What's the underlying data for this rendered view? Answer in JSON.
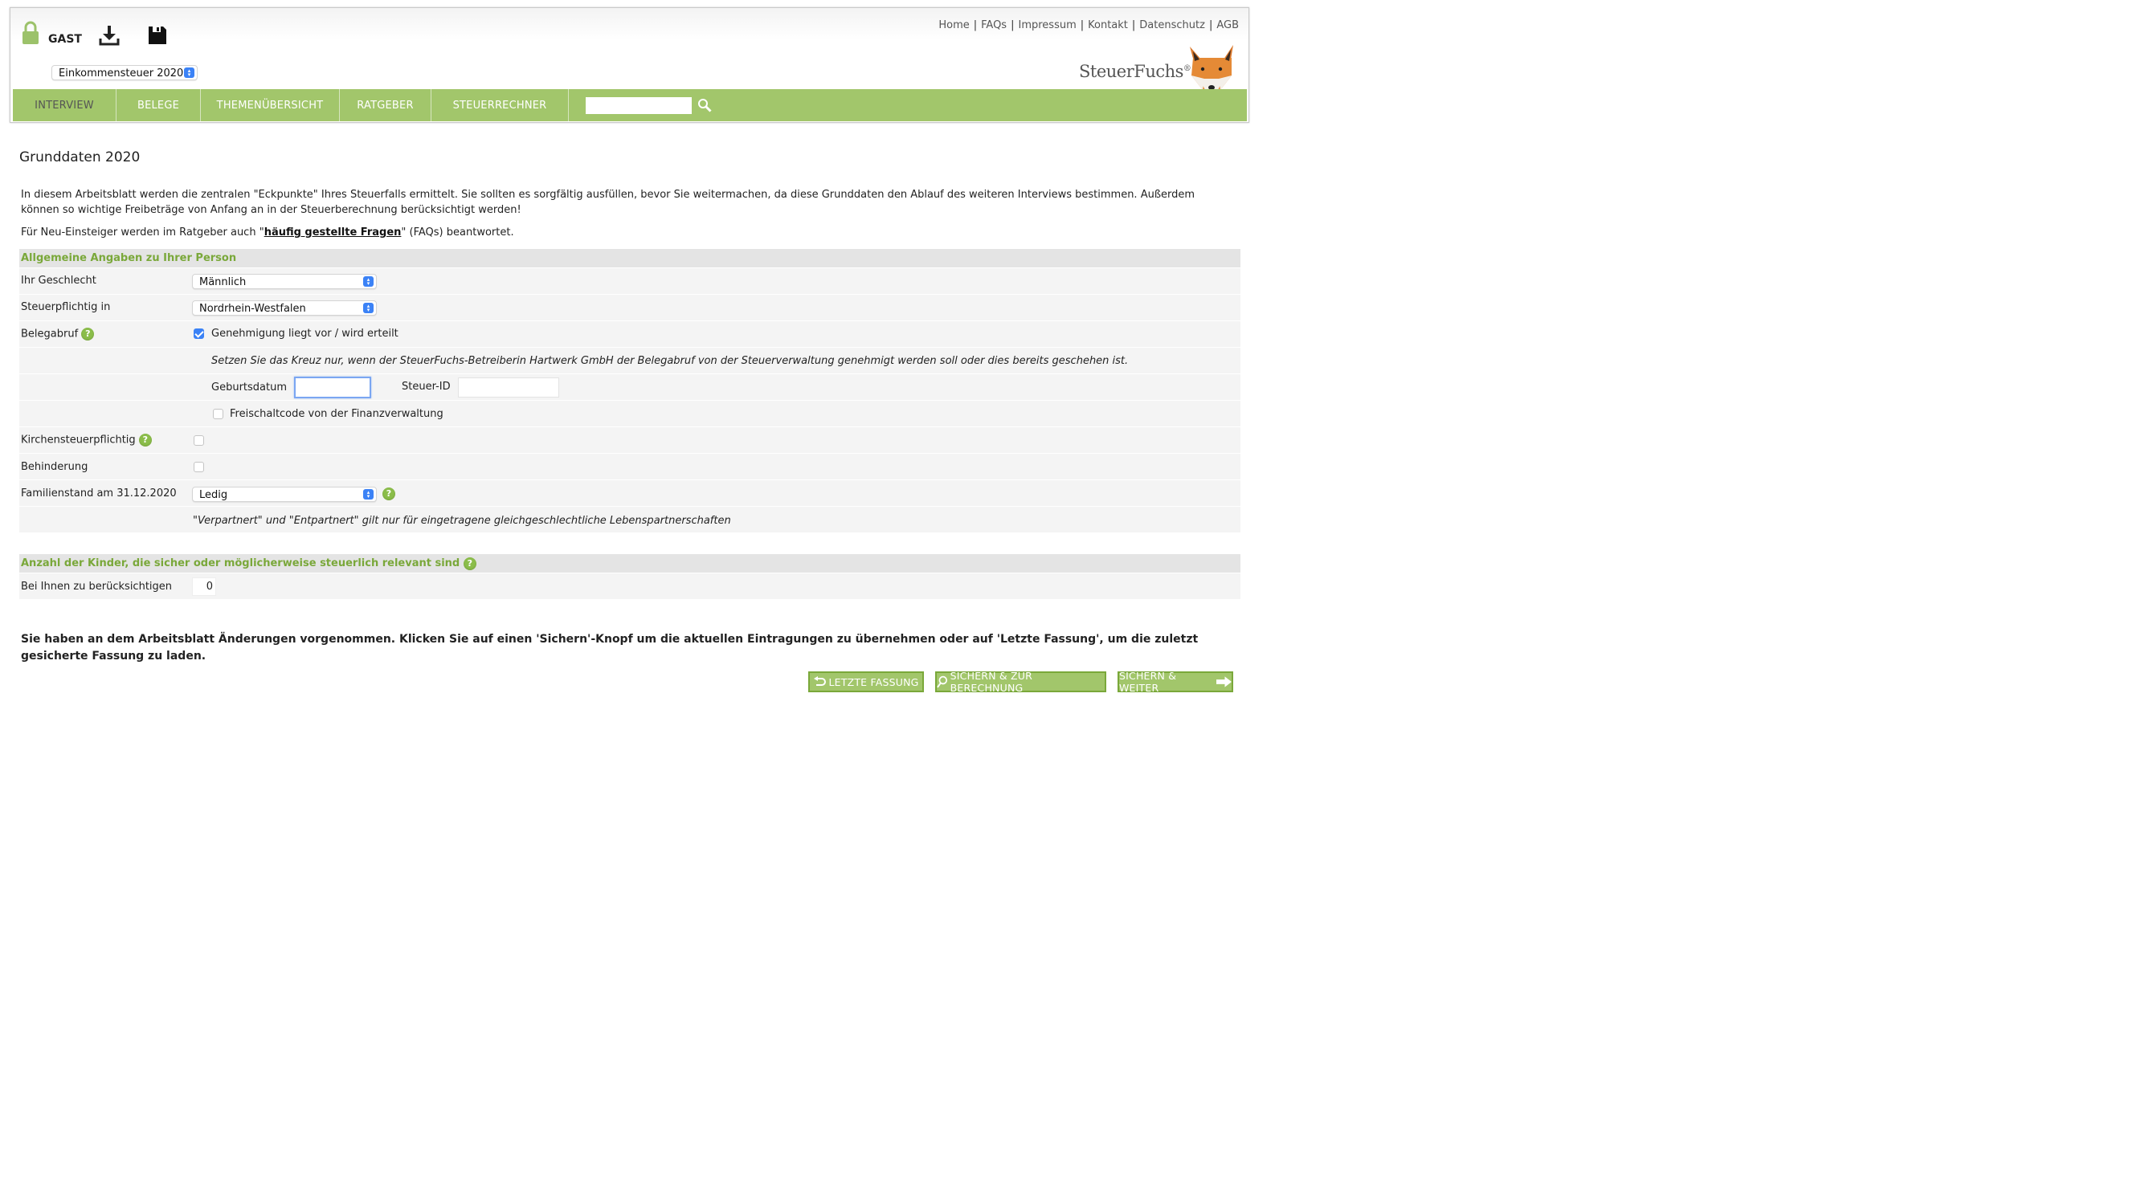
{
  "header": {
    "user_label": "GAST",
    "tax_year_select": "Einkommensteuer 2020",
    "top_links": [
      "Home",
      "FAQs",
      "Impressum",
      "Kontakt",
      "Datenschutz",
      "AGB"
    ],
    "logo_text": "SteuerFuchs",
    "logo_mark": "®"
  },
  "nav": {
    "items": [
      "INTERVIEW",
      "BELEGE",
      "THEMENÜBERSICHT",
      "RATGEBER",
      "STEUERRECHNER"
    ],
    "search_value": ""
  },
  "page": {
    "title": "Grunddaten 2020",
    "intro": "In diesem Arbeitsblatt werden die zentralen \"Eckpunkte\" Ihres Steuerfalls ermittelt. Sie sollten es sorgfältig ausfüllen, bevor Sie weitermachen, da diese Grunddaten den Ablauf des weiteren Interviews bestimmen. Außerdem können so wichtige Freibeträge von Anfang an in der Steuerberechnung berücksichtigt werden!",
    "faq_prefix": "Für Neu-Einsteiger werden im Ratgeber auch \"",
    "faq_link": "häufig gestellte Fragen",
    "faq_suffix": "\" (FAQs) beantwortet."
  },
  "section1": {
    "title": "Allgemeine Angaben zu Ihrer Person",
    "gender_label": "Ihr Geschlecht",
    "gender_value": "Männlich",
    "state_label": "Steuerpflichtig in",
    "state_value": "Nordrhein-Westfalen",
    "belegabruf_label": "Belegabruf",
    "belegabruf_checkbox_label": "Genehmigung liegt vor / wird erteilt",
    "belegabruf_checked": true,
    "belegabruf_note": "Setzen Sie das Kreuz nur, wenn der SteuerFuchs-Betreiberin Hartwerk GmbH der Belegabruf von der Steuerverwaltung genehmigt werden soll oder dies bereits geschehen ist.",
    "birthdate_label": "Geburtsdatum",
    "birthdate_value": "",
    "taxid_label": "Steuer-ID",
    "taxid_value": "",
    "activation_label": "Freischaltcode von der Finanzverwaltung",
    "activation_checked": false,
    "church_label": "Kirchensteuerpflichtig",
    "church_checked": false,
    "disability_label": "Behinderung",
    "disability_checked": false,
    "marital_label": "Familienstand am 31.12.2020",
    "marital_value": "Ledig",
    "marital_note": "\"Verpartnert\" und \"Entpartnert\" gilt nur für eingetragene gleichgeschlechtliche Lebenspartnerschaften"
  },
  "section2": {
    "title": "Anzahl der Kinder, die sicher oder möglicherweise steuerlich relevant sind",
    "children_label": "Bei Ihnen zu berücksichtigen",
    "children_value": "0"
  },
  "notice": "Sie haben an dem Arbeitsblatt Änderungen vorgenommen. Klicken Sie auf einen 'Sichern'-Knopf um die aktuellen Eintragungen zu übernehmen oder auf 'Letzte Fassung', um die zuletzt gesicherte Fassung zu laden.",
  "buttons": {
    "last_version": "LETZTE FASSUNG",
    "save_calc": "SICHERN & ZUR BERECHNUNG",
    "save_next": "SICHERN & WEITER"
  },
  "colors": {
    "nav_green": "#a2c66b",
    "section_green": "#7aa83a",
    "checkbox_blue": "#3b82f6"
  },
  "icons": [
    "lock-icon",
    "download-icon",
    "save-icon",
    "search-icon",
    "help-icon",
    "fox-logo-icon",
    "undo-icon",
    "magnifier-icon",
    "arrow-right-icon"
  ]
}
